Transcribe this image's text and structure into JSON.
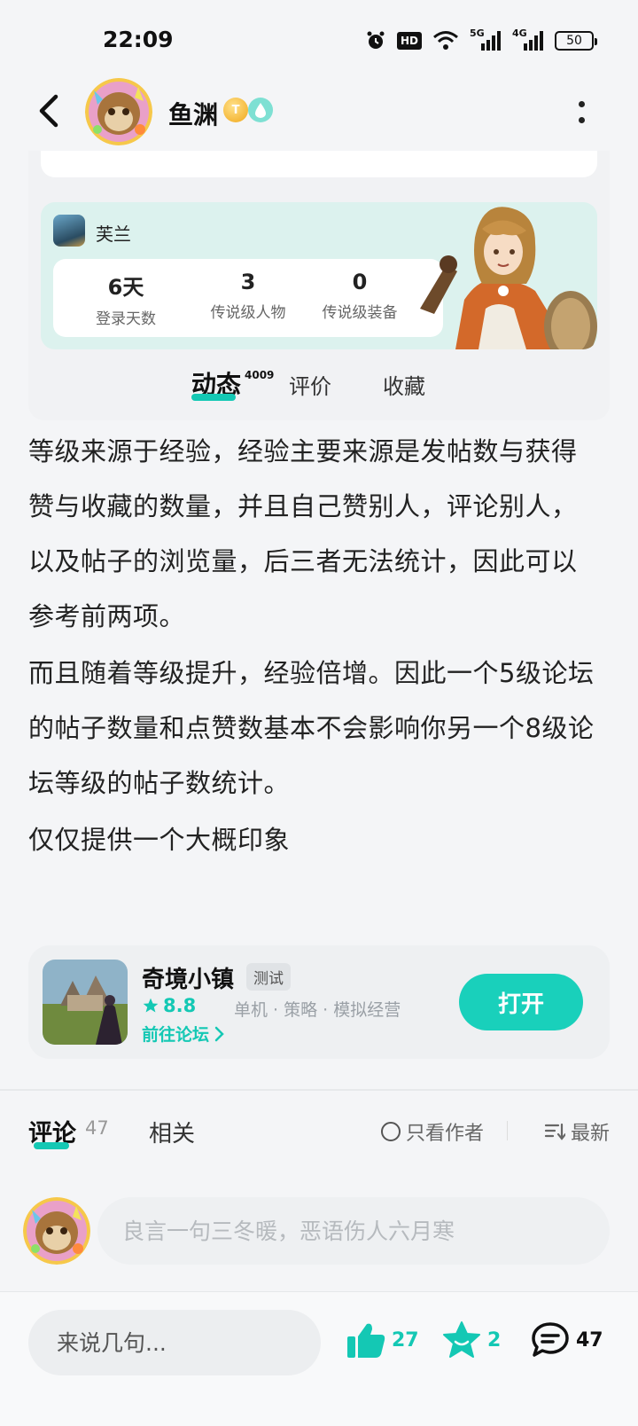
{
  "status_bar": {
    "time": "22:09",
    "hd_label": "HD",
    "net1_label": "5G",
    "net2_label": "4G",
    "battery": "50"
  },
  "header": {
    "username": "鱼渊",
    "level_badge": "T"
  },
  "game_stats": {
    "game_name": "芙兰",
    "stats": [
      {
        "value": "6天",
        "label": "登录天数"
      },
      {
        "value": "3",
        "label": "传说级人物"
      },
      {
        "value": "0",
        "label": "传说级装备"
      }
    ]
  },
  "profile_tabs": {
    "tab1": "动态",
    "tab1_count": "4009",
    "tab2": "评价",
    "tab3": "收藏"
  },
  "post": {
    "paragraphs": [
      "等级来源于经验，经验主要来源是发帖数与获得赞与收藏的数量，并且自己赞别人，评论别人，以及帖子的浏览量，后三者无法统计，因此可以参考前两项。",
      "而且随着等级提升，经验倍增。因此一个5级论坛的帖子数量和点赞数基本不会影响你另一个8级论坛等级的帖子数统计。",
      "仅仅提供一个大概印象"
    ]
  },
  "game_card": {
    "title": "奇境小镇",
    "tag": "测试",
    "score": "8.8",
    "meta": "单机 · 策略 · 模拟经营",
    "forum_link": "前往论坛",
    "open_label": "打开"
  },
  "comments": {
    "tab_active": "评论",
    "tab_active_count": "47",
    "tab_related": "相关",
    "filter_author": "只看作者",
    "sort_label": "最新",
    "input_placeholder": "良言一句三冬暖，恶语伤人六月寒"
  },
  "bottom_bar": {
    "input_placeholder": "来说几句...",
    "like_count": "27",
    "fav_count": "2",
    "comment_count": "47"
  },
  "colors": {
    "accent": "#14c8b4",
    "text": "#222222",
    "muted": "#9aa0a6"
  }
}
